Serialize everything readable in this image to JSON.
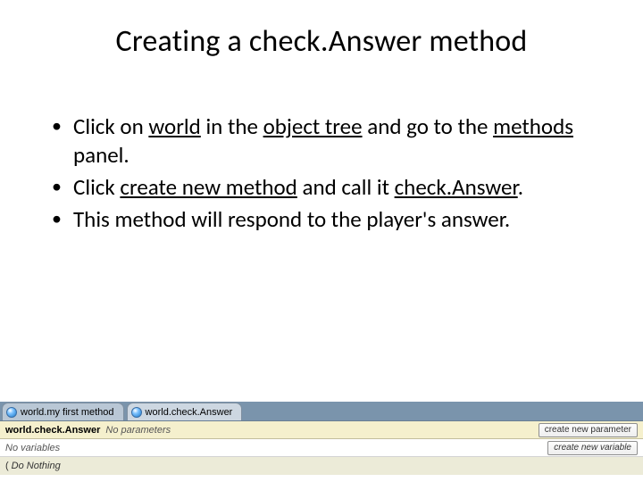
{
  "title": "Creating a check.Answer method",
  "bullets": [
    [
      {
        "t": "Click on "
      },
      {
        "t": "world",
        "u": true
      },
      {
        "t": " in the "
      },
      {
        "t": "object tree",
        "u": true
      },
      {
        "t": " and go to the "
      },
      {
        "t": "methods",
        "u": true
      },
      {
        "t": " panel."
      }
    ],
    [
      {
        "t": "Click "
      },
      {
        "t": "create new method",
        "u": true
      },
      {
        "t": " and call it "
      },
      {
        "t": "check.Answer",
        "u": true
      },
      {
        "t": "."
      }
    ],
    [
      {
        "t": "This method will respond to the player's answer."
      }
    ]
  ],
  "ui": {
    "tabs": [
      {
        "label": "world.my first method",
        "active": false
      },
      {
        "label": "world.check.Answer",
        "active": true
      }
    ],
    "signature": {
      "method_name": "world.check.Answer",
      "params_text": "No parameters",
      "new_param_btn": "create new parameter"
    },
    "vars": {
      "no_vars_text": "No variables",
      "new_var_btn": "create new variable"
    },
    "body": {
      "do_nothing": "Do Nothing"
    }
  }
}
